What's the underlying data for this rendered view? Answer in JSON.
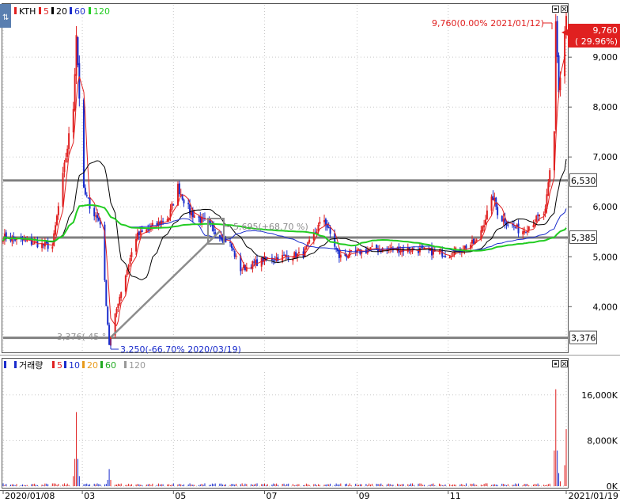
{
  "price_panel": {
    "corner_icon": "chart-mode-icon",
    "legend": [
      {
        "text": "KTH",
        "color": "#000000"
      },
      {
        "text": "5",
        "color": "#e02020"
      },
      {
        "text": "20",
        "color": "#000000"
      },
      {
        "text": "60",
        "color": "#1a2ccc"
      },
      {
        "text": "120",
        "color": "#22cc22"
      }
    ],
    "window_buttons": [
      "minimize-icon",
      "close-icon"
    ],
    "yticks": [
      "9,000",
      "8,000",
      "7,000",
      "6,000",
      "5,000",
      "4,000"
    ],
    "ytick_values": [
      9000,
      8000,
      7000,
      6000,
      5000,
      4000
    ],
    "ylim": [
      3100,
      10050
    ],
    "current_price_tag": {
      "line1": "9,760",
      "line2": "( 29.96%)"
    },
    "level_tags": [
      {
        "label": "6,530",
        "value": 6530
      },
      {
        "label": "5,385",
        "value": 5385
      },
      {
        "label": "3,376",
        "value": 3376
      }
    ],
    "annotations": {
      "high": "9,760(0.00% 2021/01/12)",
      "low": "3,250(-66.70% 2020/03/19)",
      "trendline": "5,695(+68.70 %)",
      "angle": "3,376( 45 °"
    }
  },
  "volume_panel": {
    "legend": [
      {
        "text": "거래량",
        "color": "#000000"
      },
      {
        "text": "5",
        "color": "#e02020"
      },
      {
        "text": "10",
        "color": "#1a2ccc"
      },
      {
        "text": "20",
        "color": "#e89a1a"
      },
      {
        "text": "60",
        "color": "#22aa22"
      },
      {
        "text": "120",
        "color": "#999999"
      }
    ],
    "yticks": [
      "16,000K",
      "8,000K",
      "0K"
    ],
    "ytick_values": [
      16000,
      8000,
      0
    ],
    "ylim": [
      0,
      20000
    ]
  },
  "x_axis": {
    "labels": [
      "2020/01/08",
      "03",
      "05",
      "07",
      "09",
      "11",
      "2021/01/19"
    ]
  },
  "colors": {
    "up": "#e02020",
    "down": "#1a2ccc",
    "level_line": "#808080",
    "grid": "#c8c8c8"
  },
  "chart_data": {
    "type": "candlestick",
    "instrument": "KTH",
    "x_range": [
      "2020/01/08",
      "2021/01/19"
    ],
    "moving_averages": [
      "5",
      "20",
      "60",
      "120"
    ],
    "price_keypoints": [
      {
        "date": "2020/01/08",
        "close": 5400
      },
      {
        "date": "2020/02/10",
        "close": 5200
      },
      {
        "date": "2020/02/24",
        "close": 8000
      },
      {
        "date": "2020/02/26",
        "close": 9500
      },
      {
        "date": "2020/03/02",
        "close": 6300
      },
      {
        "date": "2020/03/09",
        "close": 5850
      },
      {
        "date": "2020/03/13",
        "close": 5700
      },
      {
        "date": "2020/03/19",
        "close": 3250
      },
      {
        "date": "2020/03/25",
        "close": 4100
      },
      {
        "date": "2020/04/06",
        "close": 5400
      },
      {
        "date": "2020/04/28",
        "close": 5800
      },
      {
        "date": "2020/05/04",
        "close": 6400
      },
      {
        "date": "2020/05/12",
        "close": 5900
      },
      {
        "date": "2020/05/26",
        "close": 5600
      },
      {
        "date": "2020/06/08",
        "close": 5250
      },
      {
        "date": "2020/06/15",
        "close": 4750
      },
      {
        "date": "2020/07/01",
        "close": 4950
      },
      {
        "date": "2020/07/27",
        "close": 5050
      },
      {
        "date": "2020/08/06",
        "close": 5600
      },
      {
        "date": "2020/08/10",
        "close": 5750
      },
      {
        "date": "2020/08/20",
        "close": 5000
      },
      {
        "date": "2020/09/10",
        "close": 5150
      },
      {
        "date": "2020/10/10",
        "close": 5150
      },
      {
        "date": "2020/11/01",
        "close": 5050
      },
      {
        "date": "2020/11/20",
        "close": 5300
      },
      {
        "date": "2020/12/01",
        "close": 6200
      },
      {
        "date": "2020/12/05",
        "close": 5800
      },
      {
        "date": "2020/12/20",
        "close": 5500
      },
      {
        "date": "2021/01/05",
        "close": 5900
      },
      {
        "date": "2021/01/11",
        "close": 7500
      },
      {
        "date": "2021/01/12",
        "close": 9760
      },
      {
        "date": "2021/01/14",
        "close": 8300
      },
      {
        "date": "2021/01/19",
        "close": 9760
      }
    ],
    "horizontal_levels": [
      6530,
      5385,
      3376
    ],
    "volume_k_keypoints": [
      {
        "date": "2020/02/26",
        "volume": 13000
      },
      {
        "date": "2020/03/19",
        "volume": 3000
      },
      {
        "date": "2021/01/12",
        "volume": 17000
      },
      {
        "date": "2021/01/19",
        "volume": 10000
      }
    ]
  }
}
